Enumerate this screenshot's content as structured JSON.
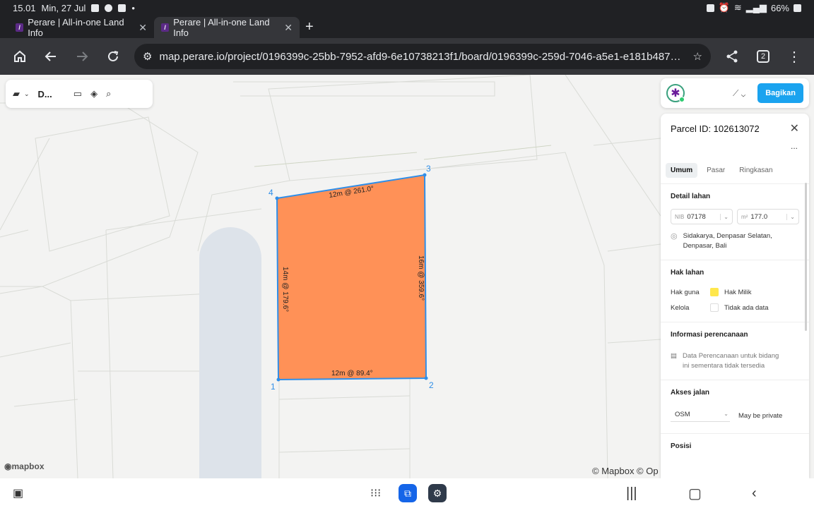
{
  "status": {
    "time": "15.01",
    "date": "Min, 27 Jul",
    "battery": "66%"
  },
  "tabs": [
    {
      "title": "Perare | All-in-one Land Info"
    },
    {
      "title": "Perare | All-in-one Land Info"
    }
  ],
  "browser": {
    "url": "map.perare.io/project/0196399c-25bb-7952-afd9-6e10738213f1/board/0196399c-259d-7046-a5e1-e181b487acc8",
    "tab_count": "2"
  },
  "map_toolbar": {
    "project_label": "D..."
  },
  "map": {
    "vertices": [
      "1",
      "2",
      "3",
      "4"
    ],
    "edge_labels": {
      "top": "12m @ 261.0°",
      "right": "16m @ 359.6°",
      "bottom": "12m @ 89.4°",
      "left": "14m @ 179.6°"
    },
    "attribution": "© Mapbox © Op",
    "logo": "mapbox",
    "parcel_color": "#ff9157",
    "outline_color": "#2f8ee8"
  },
  "header": {
    "share_label": "Bagikan"
  },
  "panel": {
    "title": "Parcel ID: 102613072",
    "more": "...",
    "tabs": [
      "Umum",
      "Pasar",
      "Ringkasan"
    ],
    "detail": {
      "heading": "Detail lahan",
      "nib_prefix": "NIB",
      "nib_value": "07178",
      "area_prefix": "m²",
      "area_value": "177.0",
      "address_line1": "Sidakarya, Denpasar Selatan,",
      "address_line2": "Denpasar, Bali"
    },
    "rights": {
      "heading": "Hak lahan",
      "use_label": "Hak guna",
      "use_value": "Hak Milik",
      "use_color": "#ffe74c",
      "manage_label": "Kelola",
      "manage_value": "Tidak ada data"
    },
    "planning": {
      "heading": "Informasi perencanaan",
      "line1": "Data Perencanaan untuk bidang",
      "line2": "ini sementara tidak tersedia"
    },
    "access": {
      "heading": "Akses jalan",
      "source": "OSM",
      "note": "May be private"
    },
    "position": {
      "heading": "Posisi"
    }
  }
}
